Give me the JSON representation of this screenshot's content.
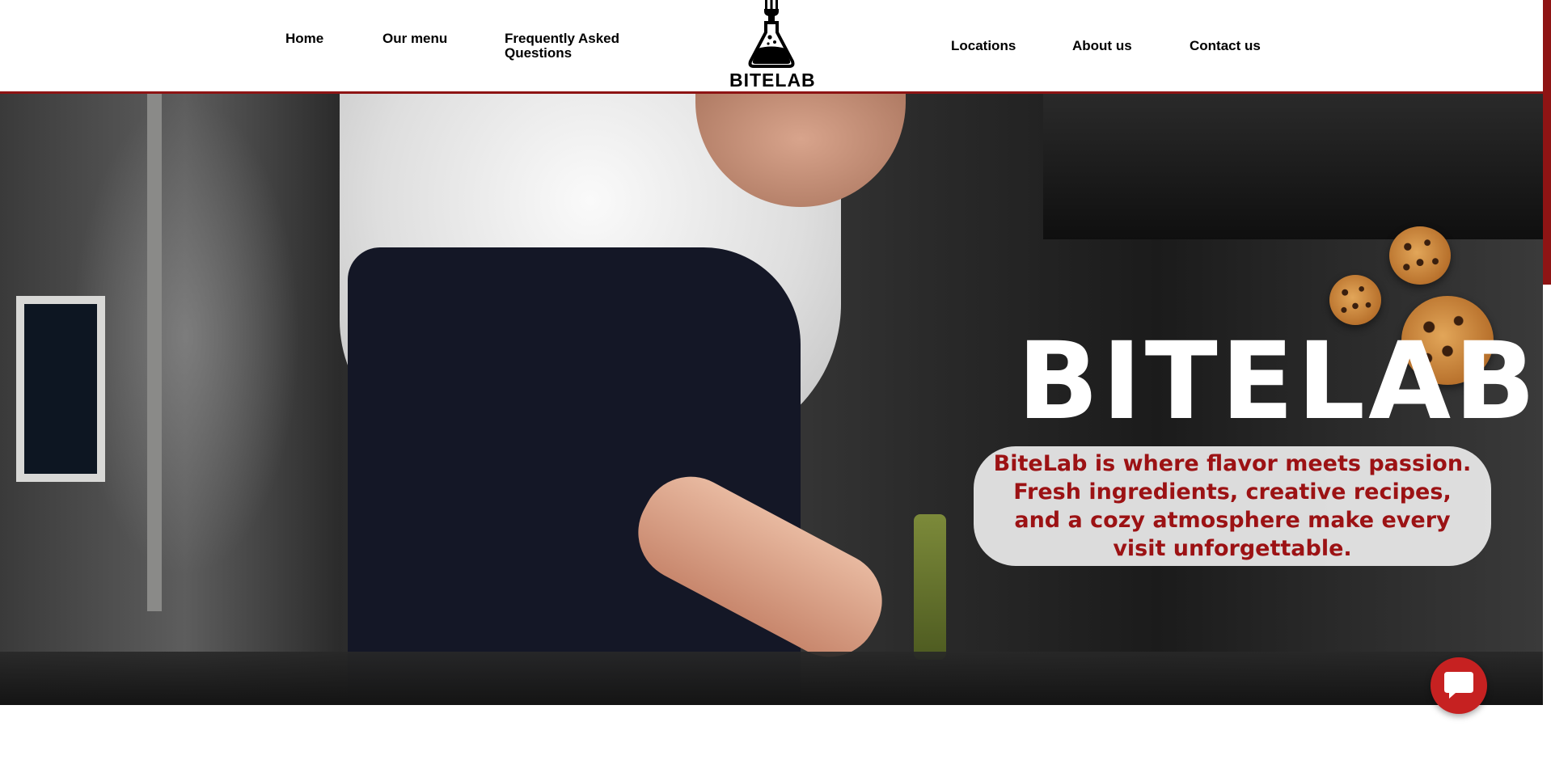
{
  "nav": {
    "left": [
      {
        "label": "Home"
      },
      {
        "label": "Our menu"
      },
      {
        "label": "Frequently Asked Questions"
      }
    ],
    "right": [
      {
        "label": "Locations"
      },
      {
        "label": "About us"
      },
      {
        "label": "Contact us"
      }
    ]
  },
  "logo": {
    "text": "BITELAB",
    "icon": "flask-fork-icon"
  },
  "hero": {
    "title": "BITELAB",
    "tagline": "BiteLab is where flavor meets passion. Fresh ingredients, creative recipes, and a cozy atmosphere make every visit unforgettable.",
    "image": "chef-plating-photo",
    "decor_icon": "cookie-icon"
  },
  "chat": {
    "icon": "chat-bubble-icon"
  },
  "colors": {
    "accent": "#8e1414",
    "tagline_text": "#9c1214",
    "chat_button": "#c62121",
    "header_bg": "#ffffff"
  }
}
